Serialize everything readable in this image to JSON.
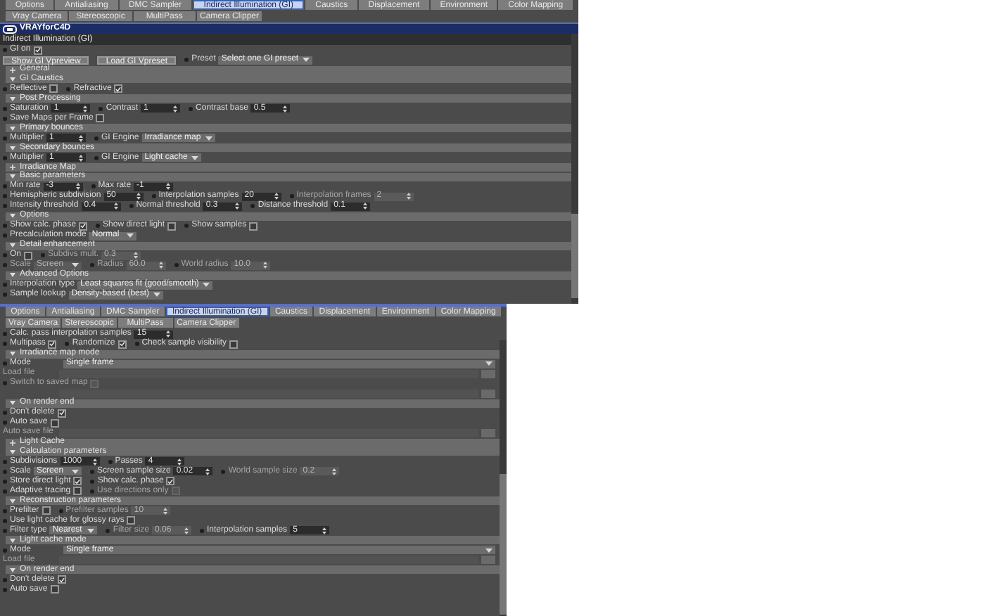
{
  "panels": [
    {
      "tab_rows": [
        [
          {
            "label": "Options",
            "selected": false
          },
          {
            "label": "Antialiasing",
            "selected": false
          },
          {
            "label": "DMC Sampler",
            "selected": false
          },
          {
            "label": "Indirect Illumination (GI)",
            "selected": true
          },
          {
            "label": "Caustics",
            "selected": false
          },
          {
            "label": "Displacement",
            "selected": false
          },
          {
            "label": "Environment",
            "selected": false
          },
          {
            "label": "Color Mapping",
            "selected": false
          }
        ],
        [
          {
            "label": "Vray Camera",
            "selected": false
          },
          {
            "label": "Stereoscopic",
            "selected": false
          },
          {
            "label": "MultiPass",
            "selected": false
          },
          {
            "label": "Camera Clipper",
            "selected": false
          }
        ]
      ],
      "logo": "VRAYforC4D",
      "title": "Indirect Illumination (GI)",
      "items": [
        {
          "kind": "row",
          "controls": [
            {
              "kind": "check",
              "label": "GI on",
              "checked": true,
              "disabled": false
            }
          ]
        },
        {
          "kind": "row",
          "controls": [
            {
              "kind": "button",
              "label": "Show GI Vpreview"
            },
            {
              "kind": "button",
              "label": "Load GI Vpreset"
            },
            {
              "kind": "dropdown",
              "label": "Preset",
              "value": "Select one GI preset",
              "disabled": false
            }
          ]
        },
        {
          "kind": "section",
          "label": "General",
          "expanded": false
        },
        {
          "kind": "section",
          "label": "GI Caustics",
          "expanded": true
        },
        {
          "kind": "row",
          "controls": [
            {
              "kind": "check",
              "label": "Reflective",
              "checked": false,
              "disabled": false
            },
            {
              "kind": "check",
              "label": "Refractive",
              "checked": true,
              "disabled": false
            }
          ]
        },
        {
          "kind": "section",
          "label": "Post Processing",
          "expanded": true
        },
        {
          "kind": "row",
          "controls": [
            {
              "kind": "number",
              "label": "Saturation",
              "value": "1",
              "disabled": false
            },
            {
              "kind": "number",
              "label": "Contrast",
              "value": "1",
              "disabled": false
            },
            {
              "kind": "number",
              "label": "Contrast base",
              "value": "0.5",
              "disabled": false
            }
          ]
        },
        {
          "kind": "row",
          "controls": [
            {
              "kind": "check",
              "label": "Save Maps per Frame",
              "checked": false,
              "disabled": false
            }
          ]
        },
        {
          "kind": "section",
          "label": "Primary bounces",
          "expanded": true
        },
        {
          "kind": "row",
          "controls": [
            {
              "kind": "number",
              "label": "Multiplier",
              "value": "1",
              "disabled": false
            },
            {
              "kind": "dropdown",
              "label": "GI Engine",
              "value": "Irradiance map",
              "disabled": false
            }
          ]
        },
        {
          "kind": "section",
          "label": "Secondary bounces",
          "expanded": true
        },
        {
          "kind": "row",
          "controls": [
            {
              "kind": "number",
              "label": "Multiplier",
              "value": "1",
              "disabled": false
            },
            {
              "kind": "dropdown",
              "label": "GI Engine",
              "value": "Light cache",
              "disabled": false
            }
          ]
        },
        {
          "kind": "section",
          "label": "Irradiance Map",
          "expanded": false
        },
        {
          "kind": "section",
          "label": "Basic parameters",
          "expanded": true
        },
        {
          "kind": "row",
          "controls": [
            {
              "kind": "number",
              "label": "Min rate",
              "value": "-3",
              "disabled": false
            },
            {
              "kind": "number",
              "label": "Max rate",
              "value": "-1",
              "disabled": false
            }
          ]
        },
        {
          "kind": "row",
          "controls": [
            {
              "kind": "number",
              "label": "Hemispheric subdivision",
              "value": "50",
              "disabled": false
            },
            {
              "kind": "number",
              "label": "Interpolation samples",
              "value": "20",
              "disabled": false
            },
            {
              "kind": "number",
              "label": "Interpolation frames",
              "value": "2",
              "disabled": true
            }
          ]
        },
        {
          "kind": "row",
          "controls": [
            {
              "kind": "number",
              "label": "Intensity threshold",
              "value": "0.4",
              "disabled": false
            },
            {
              "kind": "number",
              "label": "Normal threshold",
              "value": "0.3",
              "disabled": false
            },
            {
              "kind": "number",
              "label": "Distance threshold",
              "value": "0.1",
              "disabled": false
            }
          ]
        },
        {
          "kind": "section",
          "label": "Options",
          "expanded": true
        },
        {
          "kind": "row",
          "controls": [
            {
              "kind": "check",
              "label": "Show calc. phase",
              "checked": true,
              "disabled": false
            },
            {
              "kind": "check",
              "label": "Show direct light",
              "checked": false,
              "disabled": false
            },
            {
              "kind": "check",
              "label": "Show samples",
              "checked": false,
              "disabled": false
            }
          ]
        },
        {
          "kind": "row",
          "controls": [
            {
              "kind": "dropdown",
              "label": "Precalculation mode",
              "value": "Normal",
              "disabled": false
            }
          ]
        },
        {
          "kind": "section",
          "label": "Detail enhancement",
          "expanded": true
        },
        {
          "kind": "row",
          "controls": [
            {
              "kind": "check",
              "label": "On",
              "checked": false,
              "disabled": false
            },
            {
              "kind": "number",
              "label": "Subdivs mult.",
              "value": "0.3",
              "disabled": true
            }
          ]
        },
        {
          "kind": "row",
          "controls": [
            {
              "kind": "dropdown",
              "label": "Scale",
              "value": "Screen",
              "disabled": true
            },
            {
              "kind": "number",
              "label": "Radius",
              "value": "60.0",
              "disabled": true
            },
            {
              "kind": "number",
              "label": "World radius",
              "value": "10.0",
              "disabled": true
            }
          ]
        },
        {
          "kind": "section",
          "label": "Advanced Options",
          "expanded": true
        },
        {
          "kind": "row",
          "controls": [
            {
              "kind": "dropdown",
              "label": "Interpolation type",
              "value": "Least squares fit (good/smooth)",
              "disabled": false
            }
          ]
        },
        {
          "kind": "row",
          "controls": [
            {
              "kind": "dropdown",
              "label": "Sample lookup",
              "value": "Density-based (best)",
              "disabled": false
            }
          ]
        }
      ]
    },
    {
      "tab_rows": [
        [
          {
            "label": "Options",
            "selected": false
          },
          {
            "label": "Antialiasing",
            "selected": false
          },
          {
            "label": "DMC Sampler",
            "selected": false
          },
          {
            "label": "Indirect Illumination (GI)",
            "selected": true
          },
          {
            "label": "Caustics",
            "selected": false
          },
          {
            "label": "Displacement",
            "selected": false
          },
          {
            "label": "Environment",
            "selected": false
          },
          {
            "label": "Color Mapping",
            "selected": false
          }
        ],
        [
          {
            "label": "Vray Camera",
            "selected": false
          },
          {
            "label": "Stereoscopic",
            "selected": false
          },
          {
            "label": "MultiPass",
            "selected": false
          },
          {
            "label": "Camera Clipper",
            "selected": false
          }
        ]
      ],
      "items": [
        {
          "kind": "row",
          "controls": [
            {
              "kind": "number",
              "label": "Calc. pass interpolation samples",
              "value": "15",
              "disabled": false
            }
          ]
        },
        {
          "kind": "row",
          "controls": [
            {
              "kind": "check",
              "label": "Multipass",
              "checked": true,
              "disabled": false
            },
            {
              "kind": "check",
              "label": "Randomize",
              "checked": true,
              "disabled": false
            },
            {
              "kind": "check",
              "label": "Check sample visibility",
              "checked": false,
              "disabled": false
            }
          ]
        },
        {
          "kind": "section",
          "label": "Irradiance map mode",
          "expanded": true
        },
        {
          "kind": "row",
          "controls": [
            {
              "kind": "wide",
              "label": "Mode",
              "value": "Single frame"
            }
          ]
        },
        {
          "kind": "row",
          "controls": [
            {
              "kind": "file",
              "label": "Load file",
              "disabled": true
            }
          ]
        },
        {
          "kind": "row",
          "controls": [
            {
              "kind": "check",
              "label": "Switch to saved map",
              "checked": false,
              "disabled": true
            }
          ]
        },
        {
          "kind": "row",
          "controls": [
            {
              "kind": "file",
              "disabled": true
            }
          ]
        },
        {
          "kind": "section",
          "label": "On render end",
          "expanded": true
        },
        {
          "kind": "row",
          "controls": [
            {
              "kind": "check",
              "label": "Don't delete",
              "checked": true,
              "disabled": false
            }
          ]
        },
        {
          "kind": "row",
          "controls": [
            {
              "kind": "check",
              "label": "Auto save",
              "checked": false,
              "disabled": false
            }
          ]
        },
        {
          "kind": "row",
          "controls": [
            {
              "kind": "file",
              "label": "Auto save file",
              "disabled": true
            }
          ]
        },
        {
          "kind": "section",
          "label": "Light Cache",
          "expanded": false
        },
        {
          "kind": "section",
          "label": "Calculation parameters",
          "expanded": true
        },
        {
          "kind": "row",
          "controls": [
            {
              "kind": "number",
              "label": "Subdivisions",
              "value": "1000",
              "disabled": false
            },
            {
              "kind": "number",
              "label": "Passes",
              "value": "4",
              "disabled": false
            }
          ]
        },
        {
          "kind": "row",
          "controls": [
            {
              "kind": "dropdown",
              "label": "Scale",
              "value": "Screen",
              "disabled": false
            },
            {
              "kind": "number",
              "label": "Screen sample size",
              "value": "0.02",
              "disabled": false
            },
            {
              "kind": "number",
              "label": "World sample size",
              "value": "0.2",
              "disabled": true
            }
          ]
        },
        {
          "kind": "row",
          "controls": [
            {
              "kind": "check",
              "label": "Store direct light",
              "checked": true,
              "disabled": false
            },
            {
              "kind": "check",
              "label": "Show calc. phase",
              "checked": true,
              "disabled": false
            }
          ]
        },
        {
          "kind": "row",
          "controls": [
            {
              "kind": "check",
              "label": "Adaptive tracing",
              "checked": false,
              "disabled": false
            },
            {
              "kind": "check",
              "label": "Use directions only",
              "checked": false,
              "disabled": true
            }
          ]
        },
        {
          "kind": "section",
          "label": "Reconstruction parameters",
          "expanded": true
        },
        {
          "kind": "row",
          "controls": [
            {
              "kind": "check",
              "label": "Prefilter",
              "checked": false,
              "disabled": false
            },
            {
              "kind": "number",
              "label": "Prefilter samples",
              "value": "10",
              "disabled": true
            }
          ]
        },
        {
          "kind": "row",
          "controls": [
            {
              "kind": "check",
              "label": "Use light cache for glossy rays",
              "checked": false,
              "disabled": false
            }
          ]
        },
        {
          "kind": "row",
          "controls": [
            {
              "kind": "dropdown",
              "label": "Filter type",
              "value": "Nearest",
              "disabled": false
            },
            {
              "kind": "number",
              "label": "Filter size",
              "value": "0.06",
              "disabled": true
            },
            {
              "kind": "number",
              "label": "Interpolation samples",
              "value": "5",
              "disabled": false
            }
          ]
        },
        {
          "kind": "section",
          "label": "Light cache mode",
          "expanded": true
        },
        {
          "kind": "row",
          "controls": [
            {
              "kind": "wide",
              "label": "Mode",
              "value": "Single frame"
            }
          ]
        },
        {
          "kind": "row",
          "controls": [
            {
              "kind": "file",
              "label": "Load file",
              "disabled": true
            }
          ]
        },
        {
          "kind": "section",
          "label": "On render end",
          "expanded": true
        },
        {
          "kind": "row",
          "controls": [
            {
              "kind": "check",
              "label": "Don't delete",
              "checked": true,
              "disabled": false
            }
          ]
        },
        {
          "kind": "row",
          "controls": [
            {
              "kind": "check",
              "label": "Auto save",
              "checked": false,
              "disabled": false
            }
          ]
        }
      ]
    }
  ]
}
